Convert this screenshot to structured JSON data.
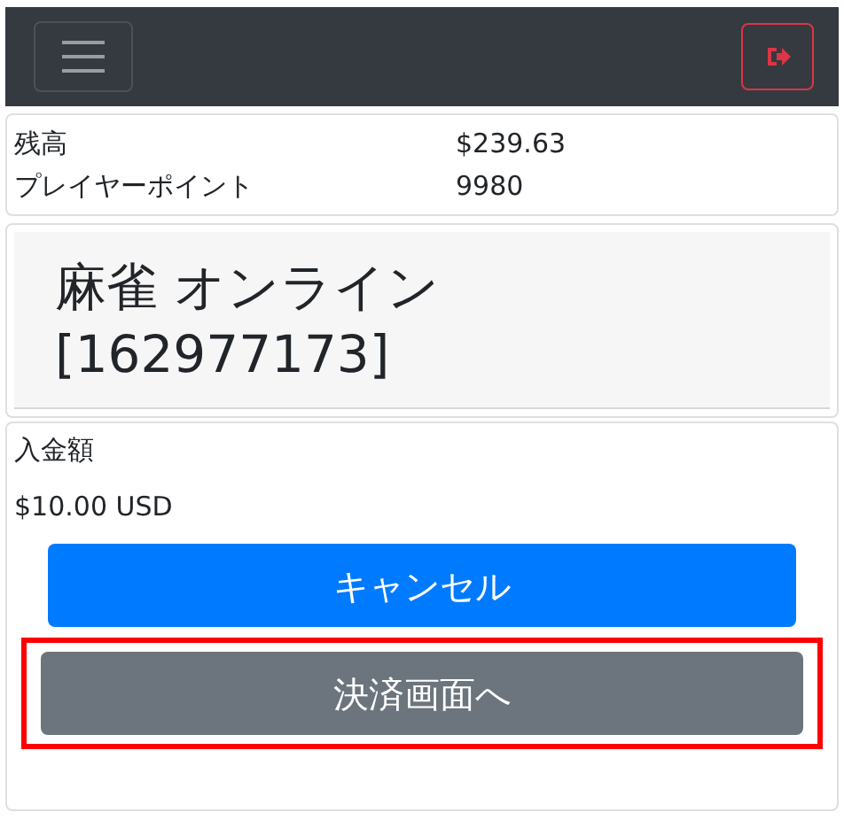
{
  "balance": [
    {
      "label": "残高",
      "value": "$239.63"
    },
    {
      "label": "プレイヤーポイント",
      "value": "9980"
    }
  ],
  "game": {
    "title_lines": [
      "麻雀 オンライン",
      "[162977173]"
    ]
  },
  "deposit": {
    "label": "入金額",
    "amount": "$10.00 USD",
    "buttons": [
      {
        "label": "キャンセル",
        "kind": "primary",
        "highlighted": false
      },
      {
        "label": "決済画面へ",
        "kind": "secondary",
        "highlighted": true
      }
    ]
  }
}
